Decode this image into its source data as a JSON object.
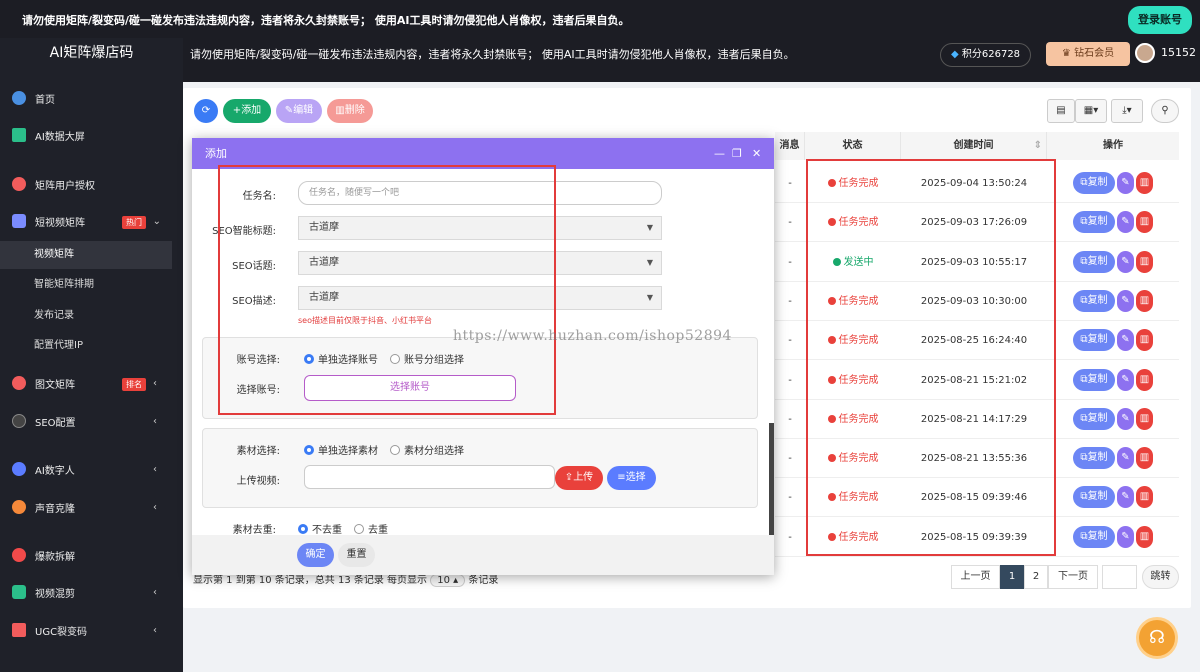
{
  "notice_text": "请勿使用矩阵/裂变码/碰一碰发布违法违规内容，违者将永久封禁账号；  使用AI工具时请勿侵犯他人肖像权，违者后果自负。",
  "login_button": "登录账号",
  "brand": "AI矩阵爆店码",
  "header_notice": "请勿使用矩阵/裂变码/碰一碰发布违法违规内容，违者将永久封禁账号；  使用AI工具时请勿侵犯他人肖像权，违者后果自负。",
  "points": "积分626728",
  "vip": "钻石会员",
  "user_id": "15152",
  "sidebar": {
    "items": [
      {
        "label": "首页",
        "icon": "pie-chart-icon",
        "color": "#4a90e2"
      },
      {
        "label": "AI数据大屏",
        "icon": "monitor-chart-icon",
        "color": "#2bbf8a"
      },
      {
        "label": "矩阵用户授权",
        "icon": "users-icon",
        "color": "#f25c5c"
      },
      {
        "label": "短视频矩阵",
        "icon": "video-icon",
        "color": "#7b8cff",
        "badge": "热门"
      },
      {
        "label": "图文矩阵",
        "icon": "image-icon",
        "color": "#f25c5c",
        "badge": "排名"
      },
      {
        "label": "SEO配置",
        "icon": "seo-icon",
        "color": "#444444"
      },
      {
        "label": "AI数字人",
        "icon": "digital-human-icon",
        "color": "#5b7cff"
      },
      {
        "label": "声音克隆",
        "icon": "voice-icon",
        "color": "#f5893a"
      },
      {
        "label": "爆款拆解",
        "icon": "fire-icon",
        "color": "#f24a4a"
      },
      {
        "label": "视频混剪",
        "icon": "film-icon",
        "color": "#2bbf8a"
      },
      {
        "label": "UGC裂变码",
        "icon": "qrcode-icon",
        "color": "#f25c5c"
      }
    ],
    "subitems": [
      "视频矩阵",
      "智能矩阵排期",
      "发布记录",
      "配置代理IP"
    ]
  },
  "toolbar": {
    "add": "添加",
    "edit": "编辑",
    "delete": "删除"
  },
  "table": {
    "headers": {
      "msg": "消息",
      "status": "状态",
      "created": "创建时间",
      "ops": "操作"
    },
    "rows": [
      {
        "msg": "-",
        "status": "任务完成",
        "time": "2025-09-04 13:50:24"
      },
      {
        "msg": "-",
        "status": "任务完成",
        "time": "2025-09-03 17:26:09"
      },
      {
        "msg": "-",
        "status": "发送中",
        "time": "2025-09-03 10:55:17"
      },
      {
        "msg": "-",
        "status": "任务完成",
        "time": "2025-09-03 10:30:00"
      },
      {
        "msg": "-",
        "status": "任务完成",
        "time": "2025-08-25 16:24:40"
      },
      {
        "msg": "-",
        "status": "任务完成",
        "time": "2025-08-21 15:21:02"
      },
      {
        "msg": "-",
        "status": "任务完成",
        "time": "2025-08-21 14:17:29"
      },
      {
        "msg": "-",
        "status": "任务完成",
        "time": "2025-08-21 13:55:36"
      },
      {
        "msg": "-",
        "status": "任务完成",
        "time": "2025-08-15 09:39:46"
      },
      {
        "msg": "-",
        "status": "任务完成",
        "time": "2025-08-15 09:39:39"
      }
    ],
    "copy_label": "复制"
  },
  "pagination": {
    "summary": "显示第 1 到第 10 条记录，总共 13 条记录 每页显示",
    "page_size": "10",
    "suffix": "条记录",
    "prev": "上一页",
    "pages": [
      "1",
      "2"
    ],
    "next": "下一页",
    "jump": "跳转"
  },
  "modal": {
    "title": "添加",
    "task_name_label": "任务名:",
    "task_name_placeholder": "任务名，随便写一个吧",
    "seo_title_label": "SEO智能标题:",
    "seo_title_value": "古道摩",
    "seo_topic_label": "SEO话题:",
    "seo_topic_value": "古道摩",
    "seo_desc_label": "SEO描述:",
    "seo_desc_value": "古道摩",
    "seo_hint": "seo描述目前仅限于抖音、小红书平台",
    "account_select_label": "账号选择:",
    "account_single": "单独选择账号",
    "account_group": "账号分组选择",
    "choose_account_label": "选择账号:",
    "choose_account_button": "选择账号",
    "material_select_label": "素材选择:",
    "material_single": "单独选择素材",
    "material_group": "素材分组选择",
    "upload_video_label": "上传视频:",
    "upload_button": "上传",
    "choose_button": "选择",
    "dedupe_label": "素材去重:",
    "dedupe_no": "不去重",
    "dedupe_yes": "去重",
    "confirm": "确定",
    "reset": "重置"
  },
  "watermark": "https://www.huzhan.com/ishop52894",
  "colors": {
    "accent": "#8d71f0",
    "danger": "#e9413b",
    "success": "#17a86b",
    "primary": "#3a7bf5",
    "highlight": "#e23b3b"
  }
}
